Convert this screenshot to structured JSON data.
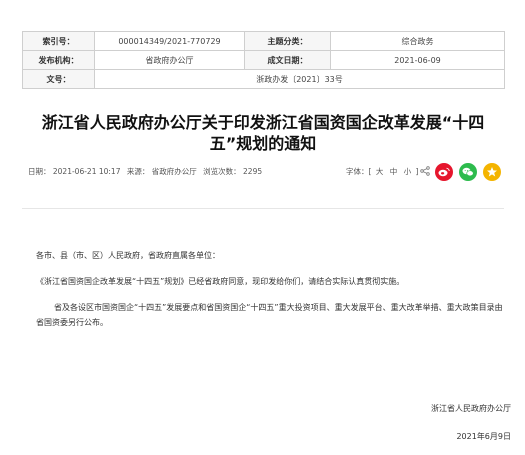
{
  "meta": {
    "index_label": "索引号：",
    "index_value": "000014349/2021-770729",
    "category_label": "主题分类：",
    "category_value": "综合政务",
    "issuer_label": "发布机构：",
    "issuer_value": "省政府办公厅",
    "date_label": "成文日期：",
    "date_value": "2021-06-09",
    "docno_label": "文号：",
    "docno_value": "浙政办发〔2021〕33号"
  },
  "title": {
    "line1": "浙江省人民政府办公厅关于印发浙江省国资国企改革发展“十四",
    "line2": "五”规划的通知"
  },
  "info": {
    "date": "日期： 2021-06-21 10:17",
    "source": "来源： 省政府办公厅",
    "views": "浏览次数： 2295"
  },
  "font_size": {
    "label": "字体：[",
    "large": "大",
    "medium": "中",
    "small": "小",
    "close": "]"
  },
  "share": {
    "weibo_icon": "weibo-icon",
    "wechat_icon": "wechat-icon",
    "qzone_icon": "qzone-icon",
    "colors": {
      "weibo": "#e6162d",
      "wechat": "#2dbb4d",
      "qzone": "#f4b400"
    }
  },
  "body": {
    "salutation": "各市、县（市、区）人民政府，省政府直属各单位：",
    "p1": "《浙江省国资国企改革发展“十四五”规划》已经省政府同意，现印发给你们，请结合实际认真贯彻实施。",
    "p2": "省及各设区市国资国企“十四五”发展要点和省国资国企“十四五”重大投资项目、重大发展平台、重大改革举措、重大政策目录由省国资委另行公布。"
  },
  "signature": {
    "org": "浙江省人民政府办公厅",
    "date": "2021年6月9日"
  }
}
